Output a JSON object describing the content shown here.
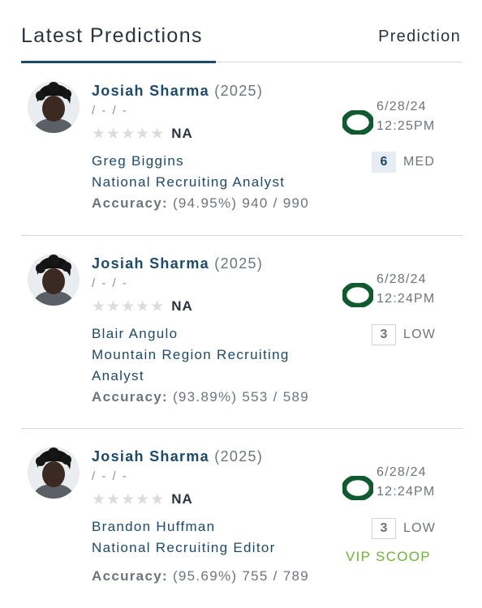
{
  "header": {
    "title": "Latest Predictions",
    "column_label": "Prediction"
  },
  "colors": {
    "primary": "#1d4a6b",
    "team_green": "#0f5a2e",
    "vip_green": "#6fb33a",
    "divider": "#d6d9dc"
  },
  "predictions": [
    {
      "player_name": "Josiah Sharma",
      "class_year": "(2025)",
      "meta": "/ - / -",
      "stars_icon": "star-icon",
      "rating": "NA",
      "analyst_name": "Greg Biggins",
      "analyst_title": "National Recruiting Analyst",
      "accuracy_label": "Accuracy:",
      "accuracy_value": "(94.95%) 940 / 990",
      "team_icon": "oregon-o-logo",
      "date": "6/28/24",
      "time": "12:25PM",
      "confidence_score": "6",
      "confidence_label": "MED",
      "vip_label": ""
    },
    {
      "player_name": "Josiah Sharma",
      "class_year": "(2025)",
      "meta": "/ - / -",
      "stars_icon": "star-icon",
      "rating": "NA",
      "analyst_name": "Blair Angulo",
      "analyst_title": "Mountain Region Recruiting Analyst",
      "accuracy_label": "Accuracy:",
      "accuracy_value": "(93.89%) 553 / 589",
      "team_icon": "oregon-o-logo",
      "date": "6/28/24",
      "time": "12:24PM",
      "confidence_score": "3",
      "confidence_label": "LOW",
      "vip_label": ""
    },
    {
      "player_name": "Josiah Sharma",
      "class_year": "(2025)",
      "meta": "/ - / -",
      "stars_icon": "star-icon",
      "rating": "NA",
      "analyst_name": "Brandon Huffman",
      "analyst_title": "National Recruiting Editor",
      "accuracy_label": "Accuracy:",
      "accuracy_value": "(95.69%) 755 / 789",
      "team_icon": "oregon-o-logo",
      "date": "6/28/24",
      "time": "12:24PM",
      "confidence_score": "3",
      "confidence_label": "LOW",
      "vip_label": "VIP SCOOP"
    }
  ]
}
